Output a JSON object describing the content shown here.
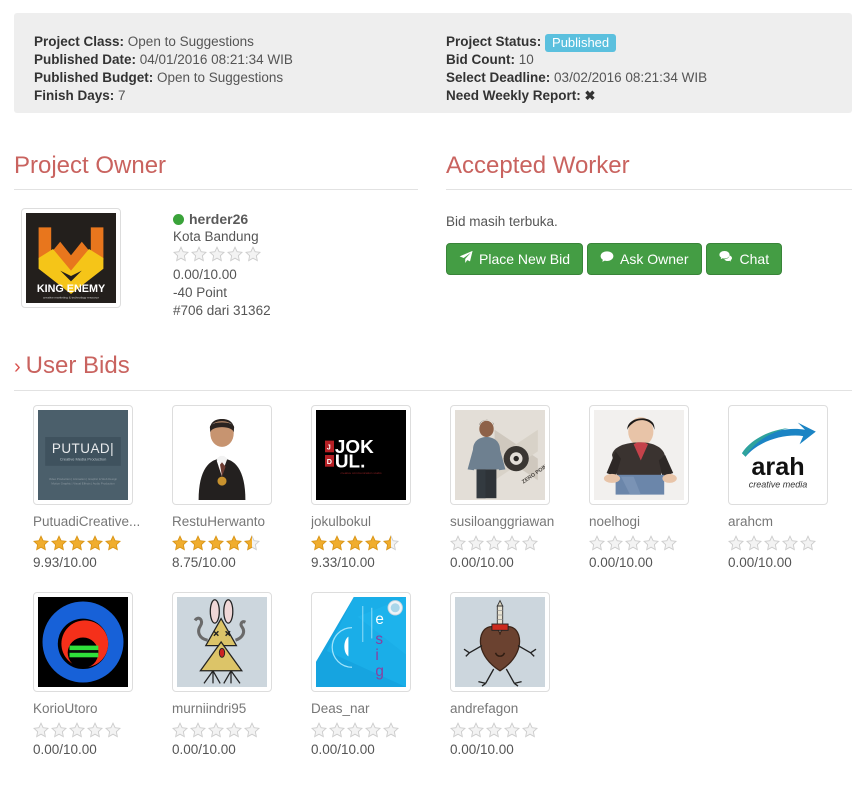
{
  "info": {
    "left": [
      {
        "label": "Project Class:",
        "value": "Open to Suggestions"
      },
      {
        "label": "Published Date:",
        "value": "04/01/2016 08:21:34 WIB"
      },
      {
        "label": "Published Budget:",
        "value": "Open to Suggestions"
      },
      {
        "label": "Finish Days:",
        "value": "7"
      }
    ],
    "right": [
      {
        "label": "Project Status:",
        "value": "Published",
        "badge": true
      },
      {
        "label": "Bid Count:",
        "value": "10"
      },
      {
        "label": "Select Deadline:",
        "value": "03/02/2016 08:21:34 WIB"
      },
      {
        "label": "Need Weekly Report:",
        "value": "✖",
        "mark": true
      }
    ]
  },
  "owner_section": {
    "title": "Project Owner",
    "name": "herder26",
    "location": "Kota Bandung",
    "rating_text": "0.00/10.00",
    "rating_stars": 0,
    "point": "-40 Point",
    "rank": "#706 dari 31362",
    "avatar_alt": "KING ENEMY"
  },
  "worker_section": {
    "title": "Accepted Worker",
    "note": "Bid masih terbuka.",
    "buttons": [
      {
        "label": "Place New Bid",
        "icon": "paper-plane-icon"
      },
      {
        "label": "Ask Owner",
        "icon": "comment-icon"
      },
      {
        "label": "Chat",
        "icon": "comments-icon"
      }
    ]
  },
  "bids_section": {
    "title": "User Bids",
    "caret": "›",
    "bids": [
      {
        "name": "PutuadiCreative...",
        "stars": 5,
        "score": "9.93/10.00",
        "art": "putuadi"
      },
      {
        "name": "RestuHerwanto",
        "stars": 4.5,
        "score": "8.75/10.00",
        "art": "restu"
      },
      {
        "name": "jokulbokul",
        "stars": 4.5,
        "score": "9.33/10.00",
        "art": "jokul"
      },
      {
        "name": "susiloanggriawan",
        "stars": 0,
        "score": "0.00/10.00",
        "art": "susilo"
      },
      {
        "name": "noelhogi",
        "stars": 0,
        "score": "0.00/10.00",
        "art": "noel"
      },
      {
        "name": "arahcm",
        "stars": 0,
        "score": "0.00/10.00",
        "art": "arah"
      },
      {
        "name": "KorioUtoro",
        "stars": 0,
        "score": "0.00/10.00",
        "art": "korio"
      },
      {
        "name": "murniindri95",
        "stars": 0,
        "score": "0.00/10.00",
        "art": "murni"
      },
      {
        "name": "Deas_nar",
        "stars": 0,
        "score": "0.00/10.00",
        "art": "deas"
      },
      {
        "name": "andrefagon",
        "stars": 0,
        "score": "0.00/10.00",
        "art": "andre"
      }
    ]
  },
  "colors": {
    "panel_bg": "#eeeeee",
    "heading": "#c9635f",
    "button_green": "#449d44",
    "badge_blue": "#5bc0de",
    "star_gold": "#f0ad2e",
    "star_empty": "#cccccc",
    "online_green": "#3aa33a"
  }
}
